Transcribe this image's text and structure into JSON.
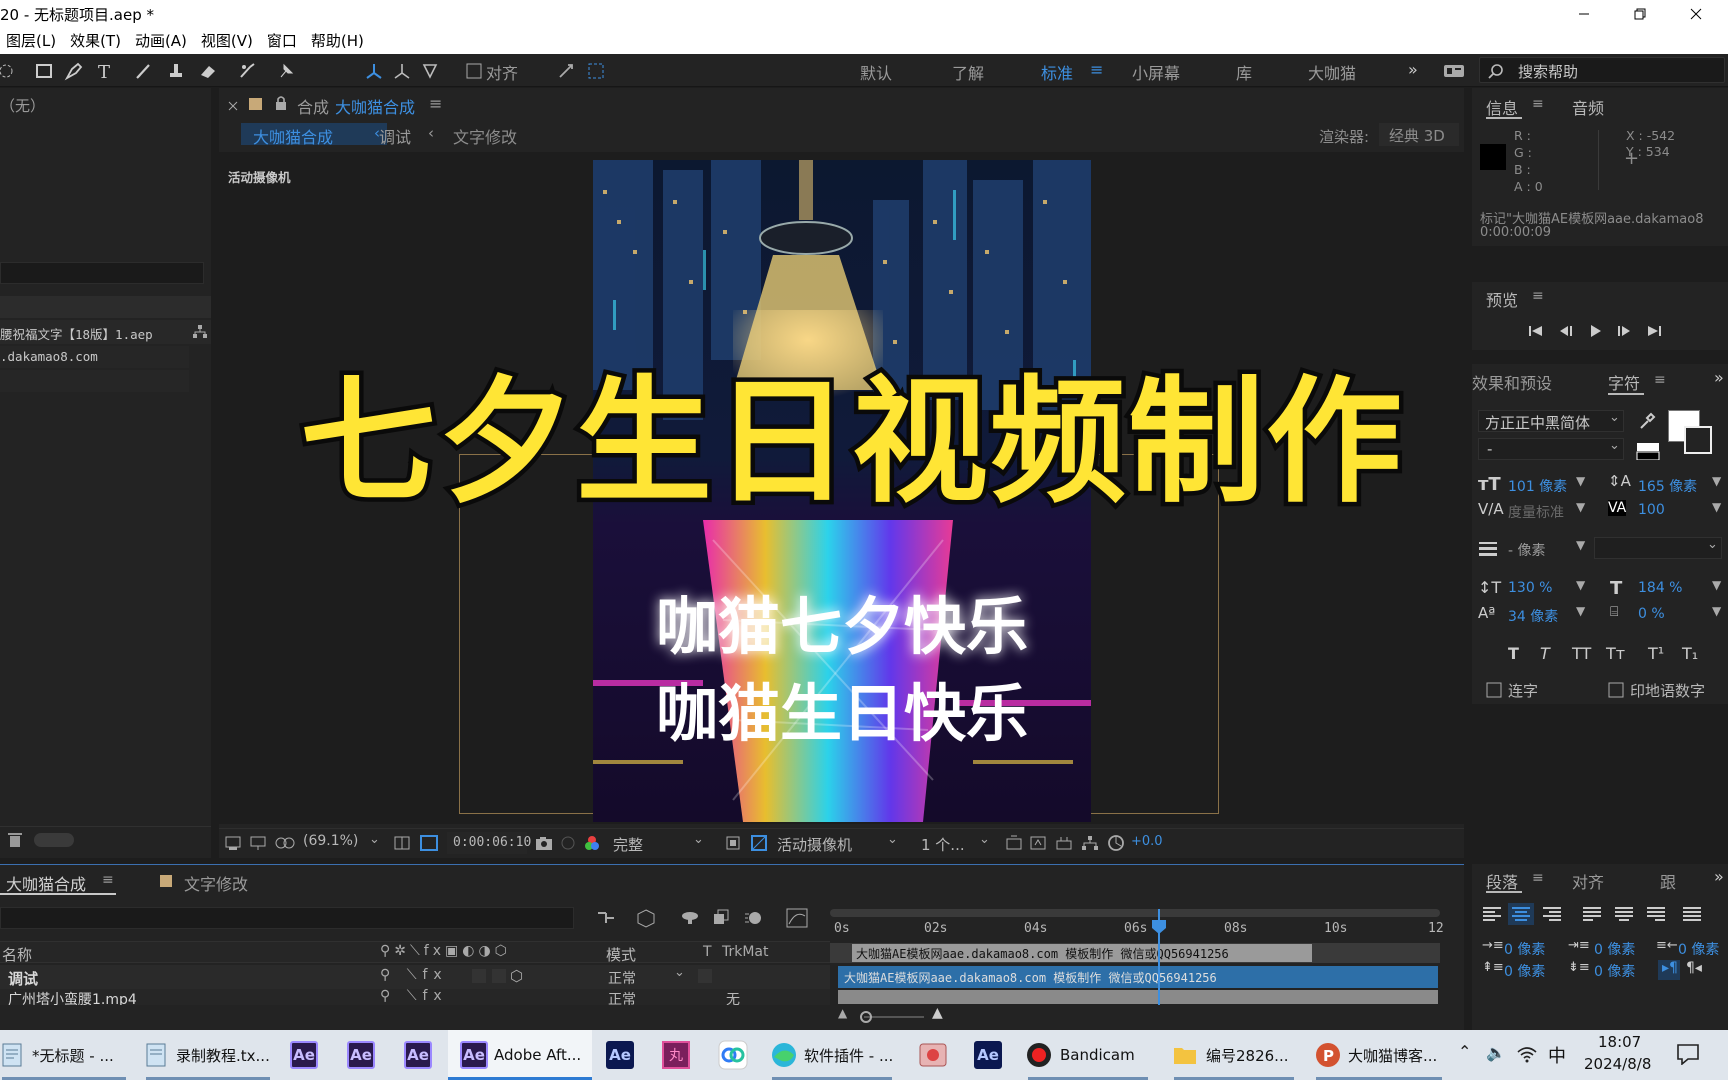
{
  "window": {
    "title": "20 - 无标题项目.aep *",
    "menus": [
      "图层(L)",
      "效果(T)",
      "动画(A)",
      "视图(V)",
      "窗口",
      "帮助(H)"
    ]
  },
  "toolbar": {
    "snap_label": "对齐",
    "workspaces": [
      "默认",
      "了解",
      "标准",
      "小屏幕",
      "库",
      "大咖猫"
    ],
    "active_workspace": "标准",
    "more": "»",
    "help_placeholder": "搜索帮助"
  },
  "project_panel": {
    "none_label": "（无）",
    "file_name": "腰祝福文字【18版】1.aep",
    "file_url": ".dakamao8.com"
  },
  "viewer": {
    "tab_prefix": "合成",
    "comp_name": "大咖猫合成",
    "breadcrumbs": [
      "大咖猫合成",
      "调试",
      "文字修改"
    ],
    "renderer_label": "渲染器:",
    "renderer_value": "经典 3D",
    "camera_label": "活动摄像机",
    "overlay_title": "七夕生日视频制作",
    "video_text_line1": "咖猫七夕快乐",
    "video_text_line2": "咖猫生日快乐",
    "footer": {
      "zoom": "(69.1%)",
      "timecode": "0:00:06:10",
      "quality": "完整",
      "camera": "活动摄像机",
      "views": "1 个...",
      "exposure": "+0.0"
    }
  },
  "info_panel": {
    "tabs": [
      "信息",
      "音频"
    ],
    "channels": [
      "R :",
      "G :",
      "B :",
      "A : 0"
    ],
    "coord_x": "X : -542",
    "coord_y": "Y : 534",
    "marker_text": "标记\"大咖猫AE模板网aae.dakamao8",
    "marker_time": "0:00:00:09"
  },
  "preview_panel": {
    "title": "预览"
  },
  "character_panel": {
    "tabs": [
      "效果和预设",
      "字符"
    ],
    "font": "方正正中黑简体",
    "style": "-",
    "size": "101 像素",
    "leading": "165 像素",
    "kerning": "度量标准",
    "tracking": "100",
    "stroke": "- 像素",
    "vscale": "130 %",
    "hscale": "184 %",
    "baseline": "34 像素",
    "tsume": "0 %",
    "style_buttons": [
      "T",
      "T",
      "TT",
      "Tт",
      "T¹",
      "T₁"
    ],
    "ligature": "连字",
    "hindi": "印地语数字"
  },
  "paragraph_panel": {
    "tabs": [
      "段落",
      "对齐",
      "跟"
    ],
    "indents": [
      "0 像素",
      "0 像素",
      "0 像素",
      "0 像素",
      "0 像素"
    ]
  },
  "timeline": {
    "tabs": [
      "大咖猫合成",
      "文字修改"
    ],
    "col_name": "名称",
    "col_mode": "模式",
    "col_t": "T",
    "col_trkmat": "TrkMat",
    "rulers": [
      "0s",
      "02s",
      "04s",
      "06s",
      "08s",
      "10s",
      "12"
    ],
    "layers": [
      {
        "name": "调试",
        "mode": "正常",
        "trkmat": ""
      },
      {
        "name": "广州塔小蛮腰1.mp4",
        "mode": "正常",
        "trkmat": "无"
      }
    ],
    "marker_text": "大咖猫AE模板网aae.dakamao8.com  模板制作  微信或QQ56941256",
    "bar_text": "大咖猫AE模板网aae.dakamao8.com  模板制作  微信或QQ56941256"
  },
  "taskbar": {
    "items": [
      "*无标题 - ...",
      "录制教程.tx...",
      "Adobe Aft...",
      "软件插件 - ...",
      "Bandicam",
      "编号2826...",
      "大咖猫博客..."
    ],
    "ae_label": "Ae",
    "ime": "中",
    "time": "18:07",
    "date": "2024/8/8"
  },
  "colors": {
    "accent_blue": "#3d8fe0",
    "title_yellow": "#ffe535",
    "panel_bg": "#232323"
  }
}
